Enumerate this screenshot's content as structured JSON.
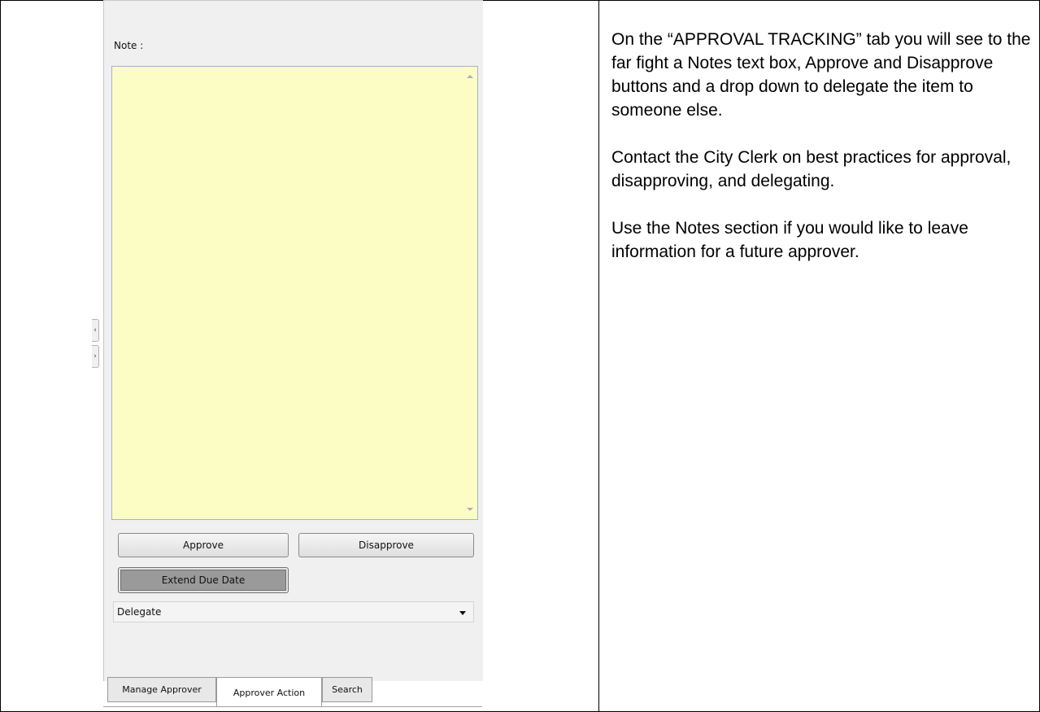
{
  "screenshot": {
    "note_label": "Note :",
    "buttons": {
      "approve": "Approve",
      "disapprove": "Disapprove",
      "extend": "Extend Due Date"
    },
    "delegate": {
      "value": "Delegate"
    },
    "tabs": [
      "Manage Approver",
      "Approver Action",
      "Search"
    ],
    "active_tab": "Approver Action",
    "note_background": "#fbfdc4"
  },
  "instructions": {
    "paragraphs": [
      "On the “APPROVAL TRACKING” tab you will see to the far fight a Notes text box, Approve and Disapprove buttons and a drop down to delegate the item to someone else.",
      "Contact the City Clerk on best practices for approval, disapproving, and delegating.",
      "Use the Notes section if you would like to leave information for a future approver."
    ]
  }
}
